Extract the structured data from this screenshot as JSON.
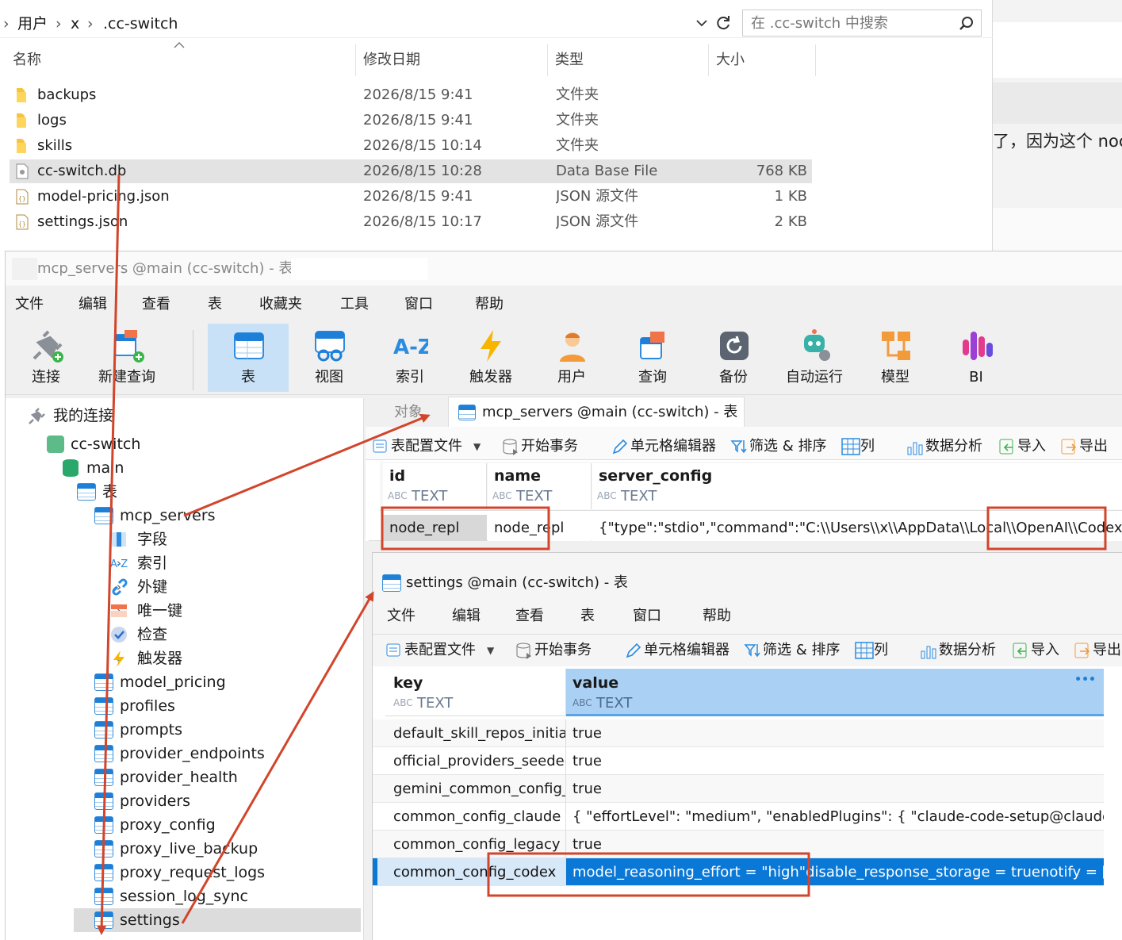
{
  "explorer": {
    "breadcrumb": [
      "用户",
      "x",
      ".cc-switch"
    ],
    "search_placeholder": "在 .cc-switch 中搜索",
    "columns": [
      "名称",
      "修改日期",
      "类型",
      "大小"
    ],
    "files": [
      {
        "name": "backups",
        "date": "2026/8/15 9:41",
        "type": "文件夹",
        "size": "",
        "kind": "folder"
      },
      {
        "name": "logs",
        "date": "2026/8/15 9:41",
        "type": "文件夹",
        "size": "",
        "kind": "folder"
      },
      {
        "name": "skills",
        "date": "2026/8/15 10:14",
        "type": "文件夹",
        "size": "",
        "kind": "folder"
      },
      {
        "name": "cc-switch.db",
        "date": "2026/8/15 10:28",
        "type": "Data Base File",
        "size": "768 KB",
        "kind": "db"
      },
      {
        "name": "model-pricing.json",
        "date": "2026/8/15 9:41",
        "type": "JSON 源文件",
        "size": "1 KB",
        "kind": "json"
      },
      {
        "name": "settings.json",
        "date": "2026/8/15 10:17",
        "type": "JSON 源文件",
        "size": "2 KB",
        "kind": "json"
      }
    ]
  },
  "background_doc": {
    "text": "了，因为这个 noc"
  },
  "navicat": {
    "title": "mcp_servers @main (cc-switch) - 表 -",
    "menu": [
      "文件",
      "编辑",
      "查看",
      "表",
      "收藏夹",
      "工具",
      "窗口",
      "帮助"
    ],
    "toolbar": [
      "连接",
      "新建查询",
      "表",
      "视图",
      "索引",
      "触发器",
      "用户",
      "查询",
      "备份",
      "自动运行",
      "模型",
      "BI"
    ],
    "tree": {
      "root": "我的连接",
      "connection": "cc-switch",
      "database": "main",
      "tables_group": "表",
      "expanded_table": "mcp_servers",
      "sub_items": [
        "字段",
        "索引",
        "外键",
        "唯一键",
        "检查",
        "触发器"
      ],
      "tables": [
        "model_pricing",
        "profiles",
        "prompts",
        "provider_endpoints",
        "provider_health",
        "providers",
        "proxy_config",
        "proxy_live_backup",
        "proxy_request_logs",
        "session_log_sync",
        "settings"
      ]
    },
    "tabs": {
      "objects": "对象",
      "active": "mcp_servers @main (cc-switch) - 表"
    },
    "subtoolbar": {
      "profile": "表配置文件",
      "begin": "开始事务",
      "cell_editor": "单元格编辑器",
      "filter": "筛选 & 排序",
      "columns": "列",
      "analysis": "数据分析",
      "import": "导入",
      "export": "导出"
    },
    "mcp_grid": {
      "columns": [
        {
          "name": "id",
          "type": "TEXT"
        },
        {
          "name": "name",
          "type": "TEXT"
        },
        {
          "name": "server_config",
          "type": "TEXT"
        }
      ],
      "row": [
        "node_repl",
        "node_repl",
        "{\"type\":\"stdio\",\"command\":\"C:\\\\Users\\\\x\\\\AppData\\\\Local\\\\OpenAI\\\\Codex\\\\r"
      ]
    },
    "settings_window": {
      "title": "settings @main (cc-switch) - 表",
      "menu": [
        "文件",
        "编辑",
        "查看",
        "表",
        "窗口",
        "帮助"
      ],
      "columns": [
        {
          "name": "key",
          "type": "TEXT"
        },
        {
          "name": "value",
          "type": "TEXT"
        }
      ],
      "more": "•••",
      "rows": [
        {
          "key": "default_skill_repos_initia",
          "value": "true"
        },
        {
          "key": "official_providers_seedec",
          "value": "true"
        },
        {
          "key": "gemini_common_config_",
          "value": "true"
        },
        {
          "key": "common_config_claude",
          "value": "{  \"effortLevel\": \"medium\",  \"enabledPlugins\": {    \"claude-code-setup@claude"
        },
        {
          "key": "common_config_legacy",
          "value": "true"
        },
        {
          "key": "common_config_codex",
          "value": "model_reasoning_effort = \"high\"disable_response_storage = truenotify = [ \"C"
        }
      ]
    }
  },
  "colors": {
    "accent": "#0a78d7",
    "annotation": "#d2452b",
    "selection": "#e3e3e3"
  }
}
